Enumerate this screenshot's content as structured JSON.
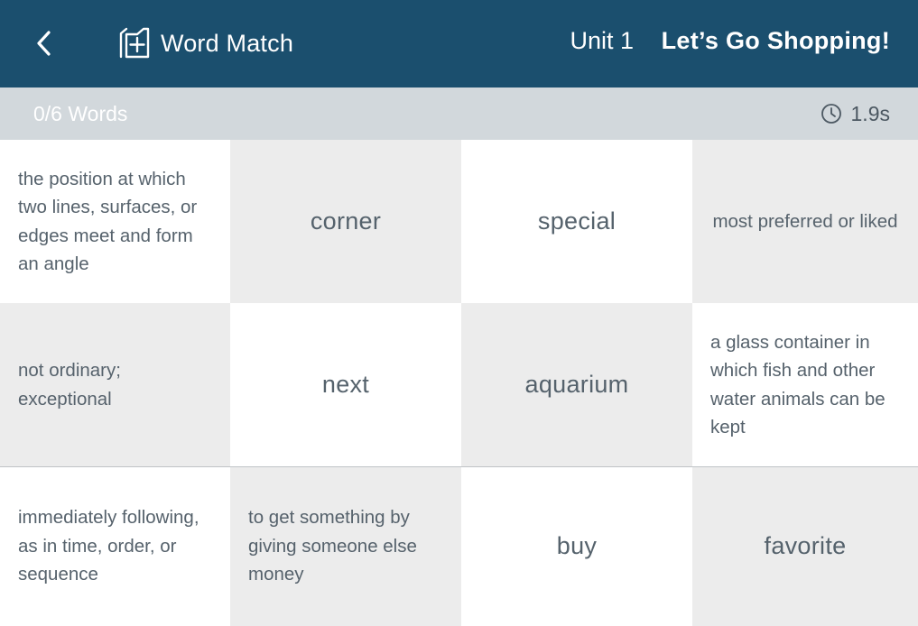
{
  "header": {
    "app_title": "Word Match",
    "unit": "Unit 1",
    "lesson": "Let’s Go Shopping!",
    "back_icon": "chevron-left-icon",
    "app_icon": "add-card-icon",
    "background": "#1b4f6e"
  },
  "status": {
    "progress": "0/6 Words",
    "timer": "1.9s",
    "timer_icon": "clock-icon"
  },
  "cards": [
    {
      "kind": "definition",
      "text": "the position at which two lines, surfaces, or edges meet and form an angle"
    },
    {
      "kind": "word",
      "text": "corner"
    },
    {
      "kind": "word",
      "text": "special"
    },
    {
      "kind": "definition",
      "text": "most preferred or liked"
    },
    {
      "kind": "definition",
      "text": "not ordinary; exceptional"
    },
    {
      "kind": "word",
      "text": "next"
    },
    {
      "kind": "word",
      "text": "aquarium"
    },
    {
      "kind": "definition",
      "text": "a glass container in which fish and other water animals can be kept"
    },
    {
      "kind": "definition",
      "text": "immediately following, as in time, order, or sequence"
    },
    {
      "kind": "definition",
      "text": "to get something by giving someone else money"
    },
    {
      "kind": "word",
      "text": "buy"
    },
    {
      "kind": "word",
      "text": "favorite"
    }
  ]
}
